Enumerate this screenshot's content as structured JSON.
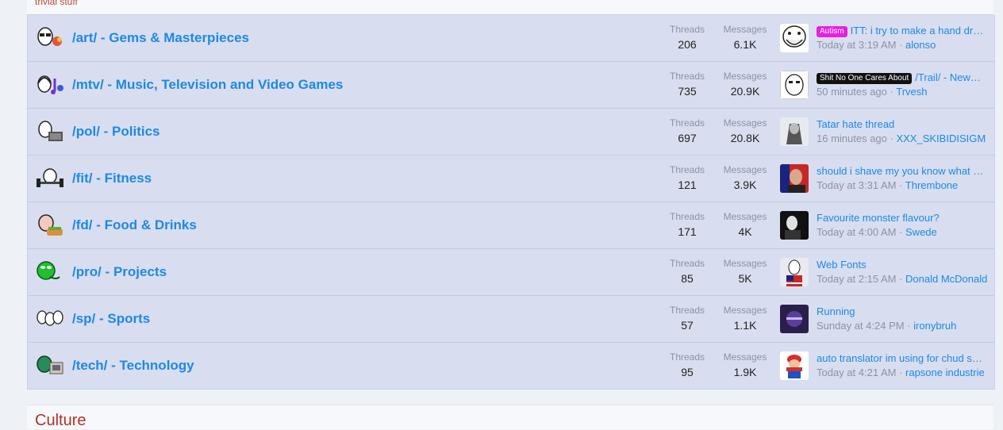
{
  "category_description": "trivial stuff",
  "forums": [
    {
      "title": "/art/ - Gems & Masterpieces",
      "threads_label": "Threads",
      "threads": "206",
      "messages_label": "Messages",
      "messages": "6.1K",
      "prefix": "Autism",
      "prefix_style": "autism",
      "latest_title": "ITT: i try to make a hand dr…",
      "latest_time": "Today at 3:19 AM",
      "latest_user": "alonso",
      "node_icon": "wojak-glasses-icon",
      "avatar_icon": "trollface-avatar"
    },
    {
      "title": "/mtv/ - Music, Television and Video Games",
      "threads_label": "Threads",
      "threads": "735",
      "messages_label": "Messages",
      "messages": "20.9K",
      "prefix": "Shit No One Cares About",
      "prefix_style": "shit",
      "latest_title": "/Trail/ - New…",
      "latest_time": "50 minutes ago",
      "latest_user": "Trvesh",
      "node_icon": "wojak-headphones-icon",
      "avatar_icon": "sketch-face-avatar"
    },
    {
      "title": "/pol/ - Politics",
      "threads_label": "Threads",
      "threads": "697",
      "messages_label": "Messages",
      "messages": "20.8K",
      "prefix": "",
      "prefix_style": "",
      "latest_title": "Tatar hate thread",
      "latest_time": "16 minutes ago",
      "latest_user": "XXX_SKIBIDISIGM",
      "node_icon": "wojak-laptop-icon",
      "avatar_icon": "warrior-avatar"
    },
    {
      "title": "/fit/ - Fitness",
      "threads_label": "Threads",
      "threads": "121",
      "messages_label": "Messages",
      "messages": "3.9K",
      "prefix": "",
      "prefix_style": "",
      "latest_title": "should i shave my you know what …",
      "latest_time": "Today at 3:31 AM",
      "latest_user": "Thrembone",
      "node_icon": "wojak-dumbbell-icon",
      "avatar_icon": "portrait-avatar"
    },
    {
      "title": "/fd/ - Food & Drinks",
      "threads_label": "Threads",
      "threads": "171",
      "messages_label": "Messages",
      "messages": "4K",
      "prefix": "",
      "prefix_style": "",
      "latest_title": "Favourite monster flavour?",
      "latest_time": "Today at 4:00 AM",
      "latest_user": "Swede",
      "node_icon": "wojak-food-icon",
      "avatar_icon": "dark-figure-avatar"
    },
    {
      "title": "/pro/ - Projects",
      "threads_label": "Threads",
      "threads": "85",
      "messages_label": "Messages",
      "messages": "5K",
      "prefix": "",
      "prefix_style": "",
      "latest_title": "Web Fonts",
      "latest_time": "Today at 2:15 AM",
      "latest_user": "Donald McDonald",
      "node_icon": "green-pepe-icon",
      "avatar_icon": "flag-wojak-avatar"
    },
    {
      "title": "/sp/ - Sports",
      "threads_label": "Threads",
      "threads": "57",
      "messages_label": "Messages",
      "messages": "1.1K",
      "prefix": "",
      "prefix_style": "",
      "latest_title": "Running",
      "latest_time": "Sunday at 4:24 PM",
      "latest_user": "ironybruh",
      "node_icon": "wojak-trio-icon",
      "avatar_icon": "purple-logo-avatar"
    },
    {
      "title": "/tech/ - Technology",
      "threads_label": "Threads",
      "threads": "95",
      "messages_label": "Messages",
      "messages": "1.9K",
      "prefix": "",
      "prefix_style": "",
      "latest_title": "auto translator im using for chud s…",
      "latest_time": "Today at 4:21 AM",
      "latest_user": "rapsone industrie",
      "node_icon": "pepe-computer-icon",
      "avatar_icon": "mario-avatar"
    }
  ],
  "next_category": "Culture"
}
